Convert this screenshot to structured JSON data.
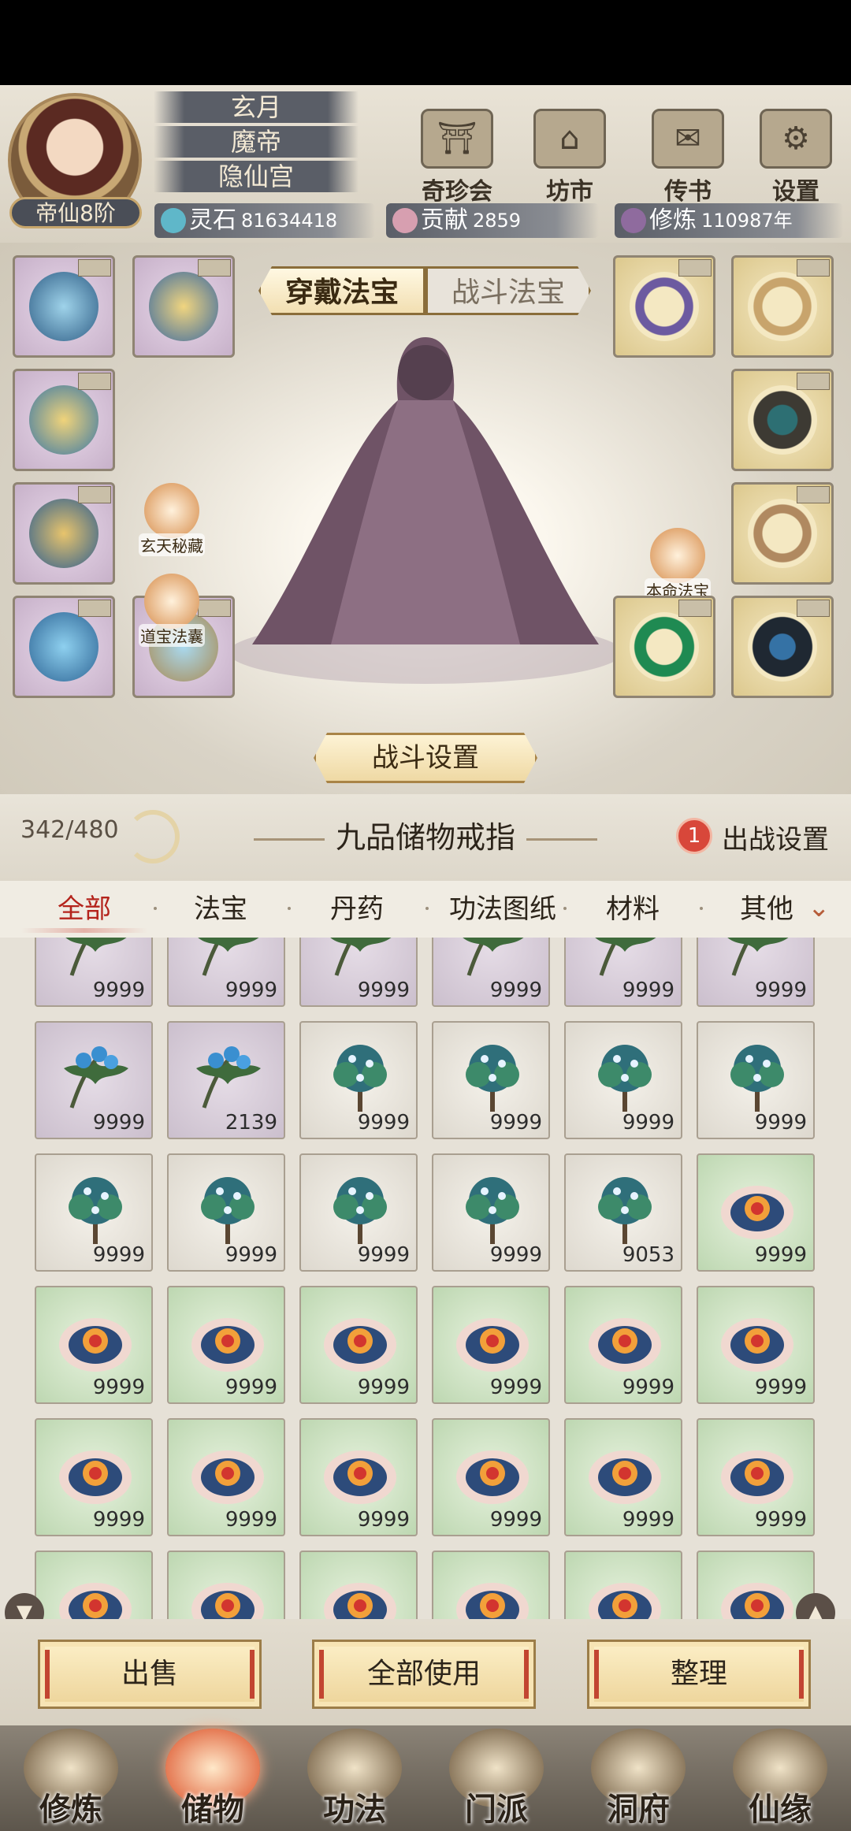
{
  "player": {
    "title": "玄月",
    "rank_name": "魔帝",
    "sect": "隐仙宫",
    "realm": "帝仙8阶"
  },
  "top_buttons": [
    "奇珍会",
    "坊市",
    "传书",
    "设置"
  ],
  "resources": {
    "spirit_stone_label": "灵石",
    "spirit_stone_value": "81634418",
    "contribution_label": "贡献",
    "contribution_value": "2859",
    "cultivation_label": "修炼",
    "cultivation_value": "110987年"
  },
  "equip_tabs": {
    "wear": "穿戴法宝",
    "battle": "战斗法宝"
  },
  "side_buttons": {
    "mystic": "玄天秘藏",
    "pouch": "道宝法囊",
    "natal": "本命法宝"
  },
  "battle_settings": "战斗设置",
  "storage": {
    "capacity": "342/480",
    "title": "九品储物戒指",
    "deploy_count": "1",
    "deploy_label": "出战设置"
  },
  "categories": [
    "全部",
    "法宝",
    "丹药",
    "功法图纸",
    "材料",
    "其他"
  ],
  "grid_rows": [
    [
      {
        "type": "leaf",
        "count": "9999"
      },
      {
        "type": "leaf",
        "count": "9999"
      },
      {
        "type": "leaf",
        "count": "9999"
      },
      {
        "type": "leaf",
        "count": "9999"
      },
      {
        "type": "leaf",
        "count": "9999"
      },
      {
        "type": "leaf",
        "count": "9999"
      }
    ],
    [
      {
        "type": "leaf",
        "count": "9999"
      },
      {
        "type": "leaf",
        "count": "2139"
      },
      {
        "type": "tree",
        "count": "9999"
      },
      {
        "type": "tree",
        "count": "9999"
      },
      {
        "type": "tree",
        "count": "9999"
      },
      {
        "type": "tree",
        "count": "9999"
      }
    ],
    [
      {
        "type": "tree",
        "count": "9999"
      },
      {
        "type": "tree",
        "count": "9999"
      },
      {
        "type": "tree",
        "count": "9999"
      },
      {
        "type": "tree",
        "count": "9999"
      },
      {
        "type": "tree",
        "count": "9053"
      },
      {
        "type": "flower",
        "count": "9999"
      }
    ],
    [
      {
        "type": "flower",
        "count": "9999"
      },
      {
        "type": "flower",
        "count": "9999"
      },
      {
        "type": "flower",
        "count": "9999"
      },
      {
        "type": "flower",
        "count": "9999"
      },
      {
        "type": "flower",
        "count": "9999"
      },
      {
        "type": "flower",
        "count": "9999"
      }
    ],
    [
      {
        "type": "flower",
        "count": "9999"
      },
      {
        "type": "flower",
        "count": "9999"
      },
      {
        "type": "flower",
        "count": "9999"
      },
      {
        "type": "flower",
        "count": "9999"
      },
      {
        "type": "flower",
        "count": "9999"
      },
      {
        "type": "flower",
        "count": "9999"
      }
    ],
    [
      {
        "type": "flower",
        "count": ""
      },
      {
        "type": "flower",
        "count": ""
      },
      {
        "type": "flower",
        "count": ""
      },
      {
        "type": "flower",
        "count": ""
      },
      {
        "type": "flower",
        "count": ""
      },
      {
        "type": "flower",
        "count": ""
      }
    ]
  ],
  "actions": {
    "sell": "出售",
    "use_all": "全部使用",
    "sort": "整理"
  },
  "nav": [
    "修炼",
    "储物",
    "功法",
    "门派",
    "洞府",
    "仙缘"
  ],
  "colors": {
    "accent_red": "#b4241c",
    "button_gold": "#edd49a",
    "rarity_purple": "#cbbfcd",
    "rarity_green": "#bdd7b1"
  }
}
